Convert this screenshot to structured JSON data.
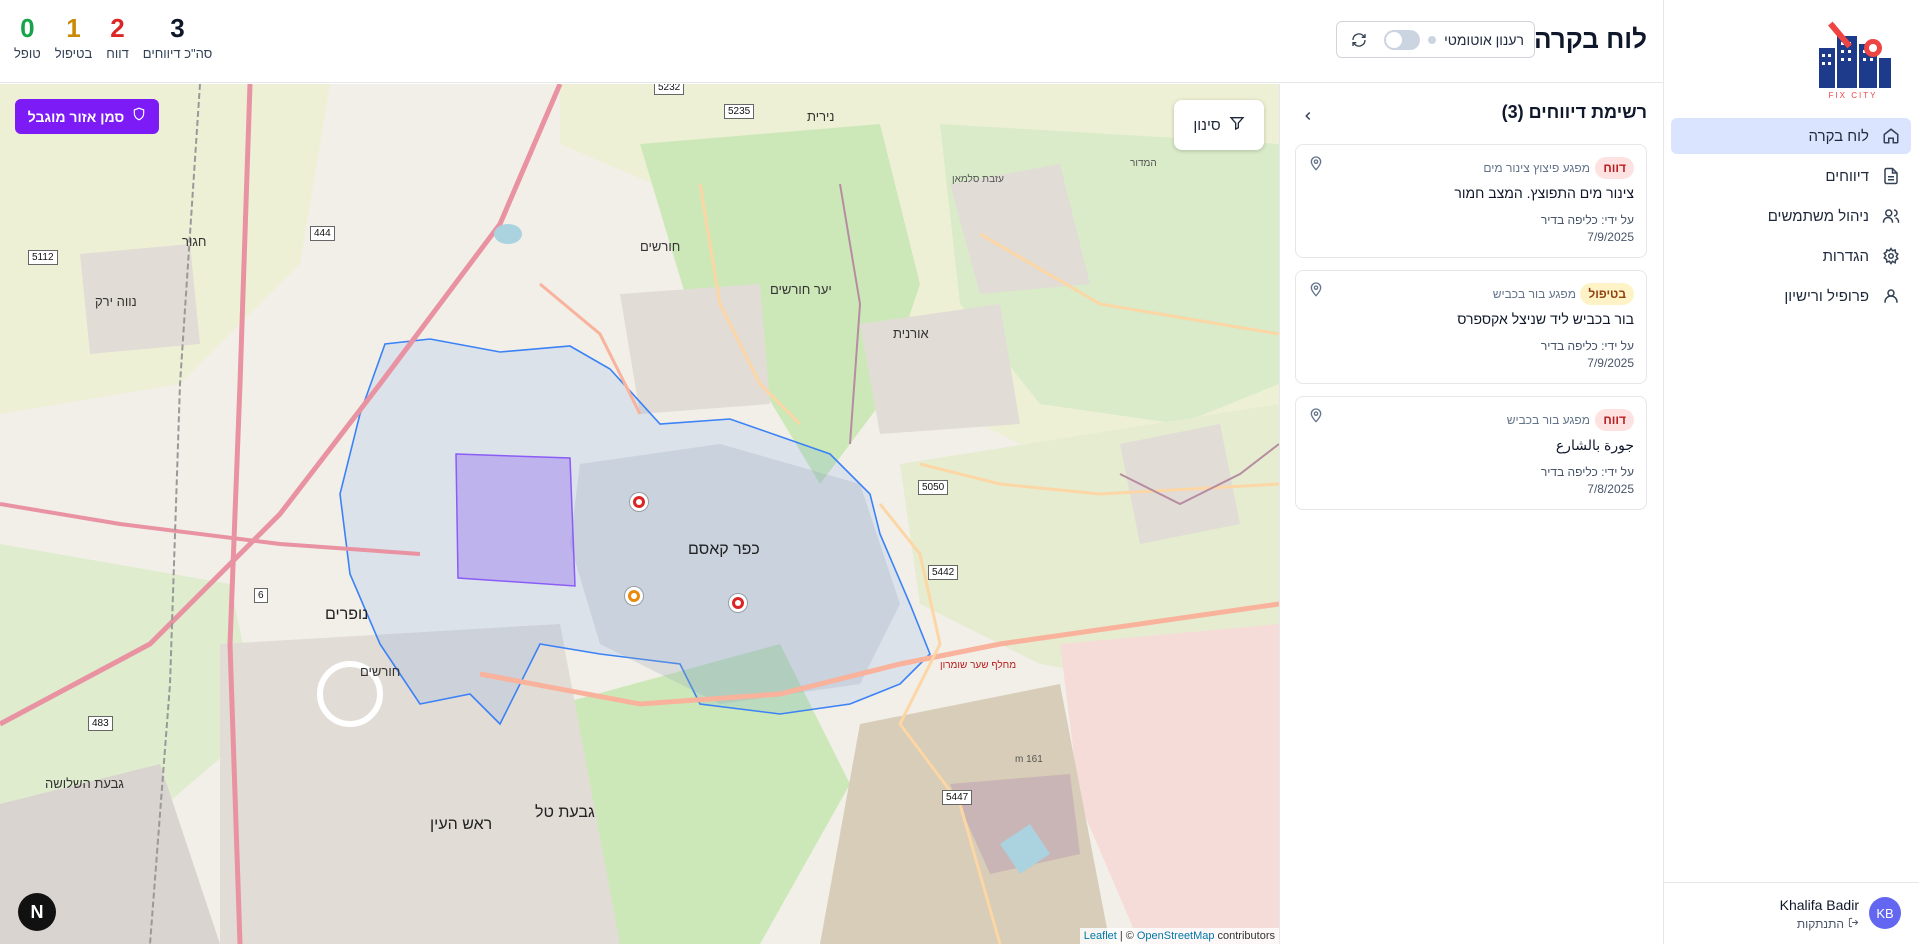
{
  "app": {
    "logo_text": "FIX CITY"
  },
  "sidebar": {
    "items": [
      {
        "label": "לוח בקרה",
        "icon": "home-icon",
        "active": true
      },
      {
        "label": "דיווחים",
        "icon": "document-icon",
        "active": false
      },
      {
        "label": "ניהול משתמשים",
        "icon": "users-icon",
        "active": false
      },
      {
        "label": "הגדרות",
        "icon": "gear-icon",
        "active": false
      },
      {
        "label": "פרופיל ורישיון",
        "icon": "user-icon",
        "active": false
      }
    ],
    "user": {
      "initials": "KB",
      "name": "Khalifa Badir",
      "logout_label": "התנתקות"
    }
  },
  "header": {
    "title": "לוח בקרה",
    "auto_refresh_label": "רענון אוטומטי",
    "auto_refresh_on": false,
    "stats": [
      {
        "value": "3",
        "label": "סה\"כ דיווחים",
        "color": "#0f172a"
      },
      {
        "value": "2",
        "label": "דווח",
        "color": "#dc2626"
      },
      {
        "value": "1",
        "label": "בטיפול",
        "color": "#ca8a04"
      },
      {
        "value": "0",
        "label": "טופל",
        "color": "#16a34a"
      }
    ]
  },
  "panel": {
    "title": "רשימת דיווחים (3)",
    "reports": [
      {
        "status": "דווח",
        "status_color": "red",
        "category": "מפגע פיצוץ צינור מים",
        "title": "צינור מים התפוצץ. המצב חמור",
        "by": "על ידי: כליפה בדיר",
        "date": "7/9/2025"
      },
      {
        "status": "בטיפול",
        "status_color": "yellow",
        "category": "מפגע בור בכביש",
        "title": "בור בכביש ליד שניצל אקספרס",
        "by": "על ידי: כליפה בדיר",
        "date": "7/9/2025"
      },
      {
        "status": "דווח",
        "status_color": "red",
        "category": "מפגע בור בכביש",
        "title": "جورة بالشارع",
        "by": "על ידי: כליפה בדיר",
        "date": "7/8/2025"
      }
    ]
  },
  "map": {
    "filter_label": "סינון",
    "zone_button_label": "סמן אזור מוגבל",
    "nav_button_label": "N",
    "attribution": {
      "leaflet": "Leaflet",
      "separator": "| ©",
      "osm": "OpenStreetMap",
      "contributors": "contributors"
    },
    "place_labels": {
      "kafr_qasim": "כפר קאסם",
      "nofarim": "נופרים",
      "horshim_1": "חורשים",
      "horshim_2": "חורשים",
      "nirit": "נירית",
      "ya_ar_horshim": "יער חורשים",
      "oranit": "אורנית",
      "rosh_haayin": "ראש העין",
      "givat_tal": "גבעת טל",
      "givat_hashlosha": "גבעת השלושה",
      "neve_yarak": "נווה ירק",
      "hagar": "חגור",
      "azza": "עזבת סלמאן",
      "sha_ar_shomron": "מחלף שער שומרון",
      "elevation": "161 m",
      "hamadior": "המדור"
    },
    "road_shields": [
      "5232",
      "5235",
      "444",
      "5112",
      "5050",
      "5442",
      "5447",
      "483",
      "6"
    ]
  },
  "colors": {
    "accent": "#7c1bf5",
    "nav_active": "#dbe4fe",
    "marker_red": "#dc2626",
    "marker_orange": "#ea8a0c",
    "boundary": "#3b82f6",
    "zone": "#8b5cf6"
  }
}
